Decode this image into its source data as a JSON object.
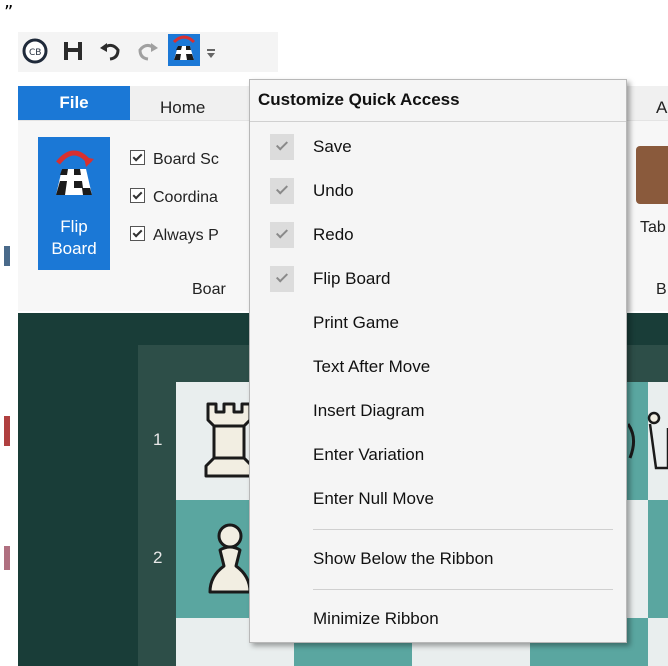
{
  "top_mark": "”",
  "quick_access": {
    "buttons": [
      "app-logo",
      "save",
      "undo",
      "redo",
      "flip-board",
      "customize-dropdown"
    ]
  },
  "tabs": {
    "file": "File",
    "home": "Home",
    "right_cut": "A"
  },
  "ribbon": {
    "flip_board_line1": "Flip",
    "flip_board_line2": "Board",
    "checkboxes": [
      "Board Sc",
      "Coordina",
      "Always P"
    ],
    "group_label": "Boar",
    "right_group_label": "B",
    "right_button_label": "Tab"
  },
  "board": {
    "ranks": [
      "1",
      "2"
    ]
  },
  "menu": {
    "title": "Customize Quick Access",
    "items": [
      {
        "label": "Save",
        "checked": true
      },
      {
        "label": "Undo",
        "checked": true
      },
      {
        "label": "Redo",
        "checked": true
      },
      {
        "label": "Flip Board",
        "checked": true
      },
      {
        "label": "Print Game",
        "checked": false
      },
      {
        "label": "Text After Move",
        "checked": false
      },
      {
        "label": "Insert Diagram",
        "checked": false
      },
      {
        "label": "Enter Variation",
        "checked": false
      },
      {
        "label": "Enter Null Move",
        "checked": false
      },
      {
        "label": "Show Below the Ribbon",
        "checked": false
      },
      {
        "label": "Minimize Ribbon",
        "checked": false
      }
    ]
  },
  "colors": {
    "accent": "#1b78d6",
    "board_dark": "#193d38",
    "square_light": "#e9eeee",
    "square_teal": "#5aa6a0"
  }
}
